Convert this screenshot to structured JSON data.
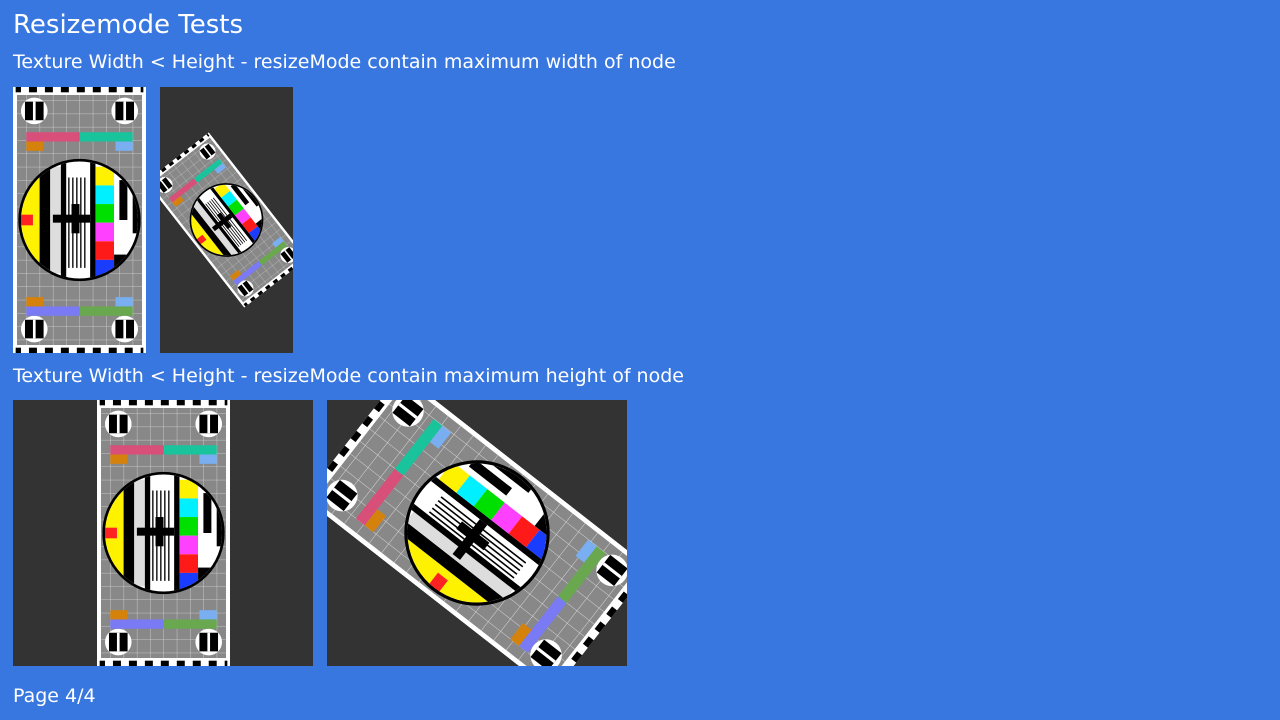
{
  "page": {
    "title": "Resizemode Tests",
    "sections": [
      {
        "caption": "Texture Width < Height - resizeMode contain maximum width of node"
      },
      {
        "caption": "Texture Width < Height - resizeMode contain maximum height of node"
      }
    ],
    "footer": "Page 4/4"
  },
  "colors": {
    "background": "#3877e0",
    "node_background": "#333333",
    "text": "#ffffff"
  }
}
